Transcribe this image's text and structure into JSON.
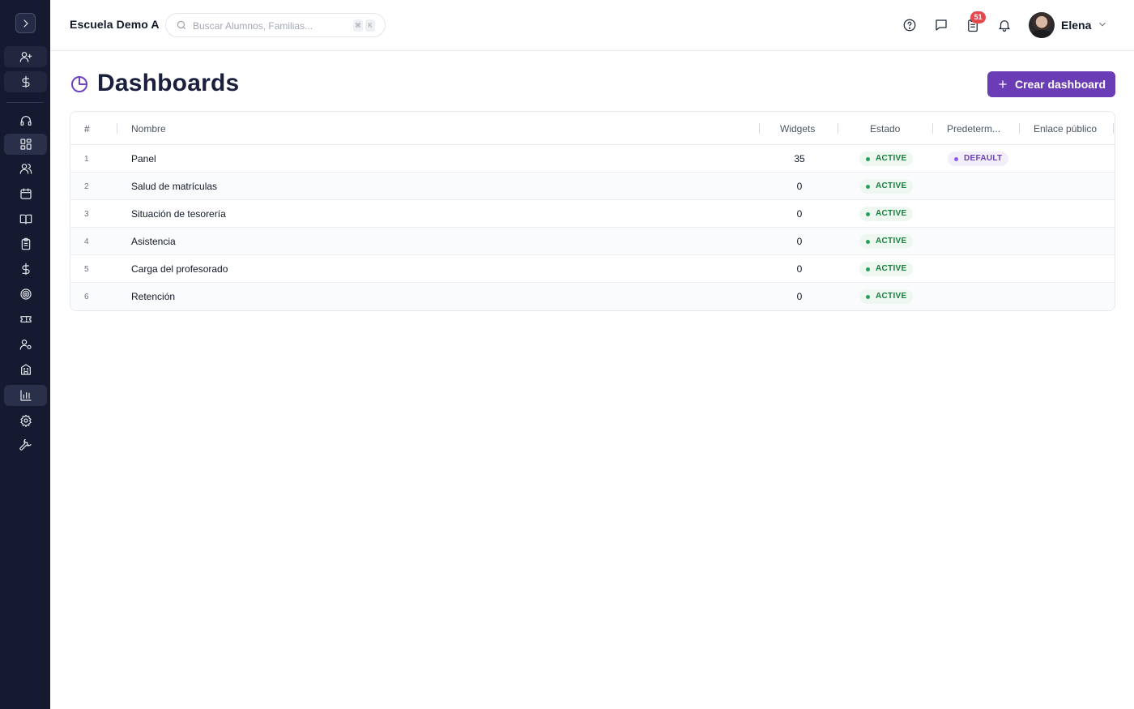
{
  "sidebar": {
    "toggle_icon": "chevron-right-icon",
    "top_items": [
      {
        "name": "add-student",
        "icon": "user-plus-icon"
      },
      {
        "name": "billing",
        "icon": "dollar-icon"
      }
    ],
    "items": [
      {
        "name": "support",
        "icon": "headset-icon"
      },
      {
        "name": "dashboards",
        "icon": "grid-icon",
        "active": true
      },
      {
        "name": "people",
        "icon": "users-icon"
      },
      {
        "name": "calendar",
        "icon": "calendar-icon"
      },
      {
        "name": "courses",
        "icon": "book-icon"
      },
      {
        "name": "tasks",
        "icon": "clipboard-icon"
      },
      {
        "name": "payments",
        "icon": "dollar-icon"
      },
      {
        "name": "goals",
        "icon": "target-icon"
      },
      {
        "name": "tickets",
        "icon": "ticket-icon"
      },
      {
        "name": "staff-settings",
        "icon": "user-gear-icon"
      },
      {
        "name": "buildings",
        "icon": "building-icon"
      },
      {
        "name": "reports",
        "icon": "bar-chart-icon",
        "active": true
      },
      {
        "name": "settings",
        "icon": "gear-icon"
      },
      {
        "name": "tools",
        "icon": "wrench-icon"
      }
    ]
  },
  "header": {
    "school_name": "Escuela Demo A",
    "search": {
      "placeholder": "Buscar Alumnos, Familias...",
      "shortcut": [
        "⌘",
        "K"
      ]
    },
    "tasks_badge": "51",
    "user": {
      "name": "Elena"
    }
  },
  "page": {
    "title": "Dashboards",
    "create_label": "Crear dashboard",
    "accent": "#6a3cb5"
  },
  "table": {
    "columns": [
      "#",
      "Nombre",
      "Widgets",
      "Estado",
      "Predeterm...",
      "Enlace público"
    ],
    "rows": [
      {
        "num": "1",
        "name": "Panel",
        "widgets": "35",
        "status": "ACTIVE",
        "default": "DEFAULT"
      },
      {
        "num": "2",
        "name": "Salud de matrículas",
        "widgets": "0",
        "status": "ACTIVE",
        "default": ""
      },
      {
        "num": "3",
        "name": "Situación de tesorería",
        "widgets": "0",
        "status": "ACTIVE",
        "default": ""
      },
      {
        "num": "4",
        "name": "Asistencia",
        "widgets": "0",
        "status": "ACTIVE",
        "default": ""
      },
      {
        "num": "5",
        "name": "Carga del profesorado",
        "widgets": "0",
        "status": "ACTIVE",
        "default": ""
      },
      {
        "num": "6",
        "name": "Retención",
        "widgets": "0",
        "status": "ACTIVE",
        "default": ""
      }
    ]
  }
}
